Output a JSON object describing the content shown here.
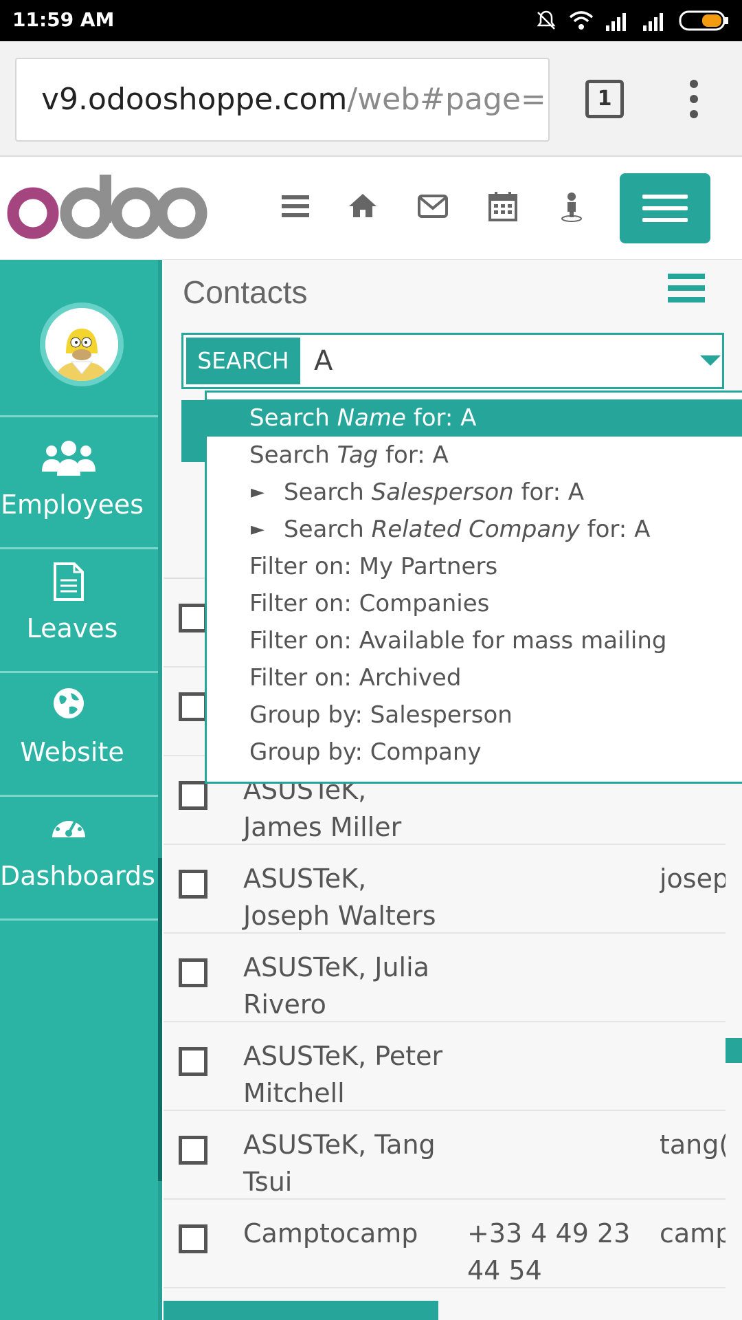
{
  "status_bar": {
    "time": "11:59 AM"
  },
  "browser": {
    "url_host": "v9.odooshoppe.com",
    "url_path": "/web#page=(",
    "tab_count": "1"
  },
  "sidebar": {
    "items": [
      {
        "label": "Employees",
        "icon": "users-icon"
      },
      {
        "label": "Leaves",
        "icon": "document-icon"
      },
      {
        "label": "Website",
        "icon": "globe-icon"
      },
      {
        "label": "Dashboards",
        "icon": "dashboard-icon"
      }
    ]
  },
  "main": {
    "title": "Contacts",
    "search": {
      "label": "SEARCH",
      "value": "A"
    },
    "dropdown": [
      {
        "prefix": "Search ",
        "em": "Name",
        "suffix": " for: A",
        "expandable": false
      },
      {
        "prefix": "Search ",
        "em": "Tag",
        "suffix": " for: A",
        "expandable": false
      },
      {
        "prefix": "Search ",
        "em": "Salesperson",
        "suffix": " for: A",
        "expandable": true
      },
      {
        "prefix": "Search ",
        "em": "Related Company",
        "suffix": " for: A",
        "expandable": true
      },
      {
        "prefix": "Filter on: My Partners",
        "em": "",
        "suffix": "",
        "expandable": false
      },
      {
        "prefix": "Filter on: Companies",
        "em": "",
        "suffix": "",
        "expandable": false
      },
      {
        "prefix": "Filter on: Available for mass mailing",
        "em": "",
        "suffix": "",
        "expandable": false
      },
      {
        "prefix": "Filter on: Archived",
        "em": "",
        "suffix": "",
        "expandable": false
      },
      {
        "prefix": "Group by: Salesperson",
        "em": "",
        "suffix": "",
        "expandable": false
      },
      {
        "prefix": "Group by: Company",
        "em": "",
        "suffix": "",
        "expandable": false
      }
    ],
    "rows": [
      {
        "name": "",
        "phone": "",
        "email": ""
      },
      {
        "name": "",
        "phone": "",
        "email": ""
      },
      {
        "name": "ASUSTeK, James Miller",
        "phone": "",
        "email": ""
      },
      {
        "name": "ASUSTeK, Joseph Walters",
        "phone": "",
        "email": "josep"
      },
      {
        "name": "ASUSTeK, Julia Rivero",
        "phone": "",
        "email": ""
      },
      {
        "name": "ASUSTeK, Peter Mitchell",
        "phone": "",
        "email": ""
      },
      {
        "name": "ASUSTeK, Tang Tsui",
        "phone": "",
        "email": "tang("
      },
      {
        "name": "Camptocamp",
        "phone": "+33 4 49 23 44 54",
        "email": "camp"
      },
      {
        "name": "",
        "phone": "",
        "email": ""
      }
    ]
  },
  "colors": {
    "accent": "#26a69a",
    "sidebar": "#2bb3a4",
    "logo_purple": "#a4457f"
  }
}
